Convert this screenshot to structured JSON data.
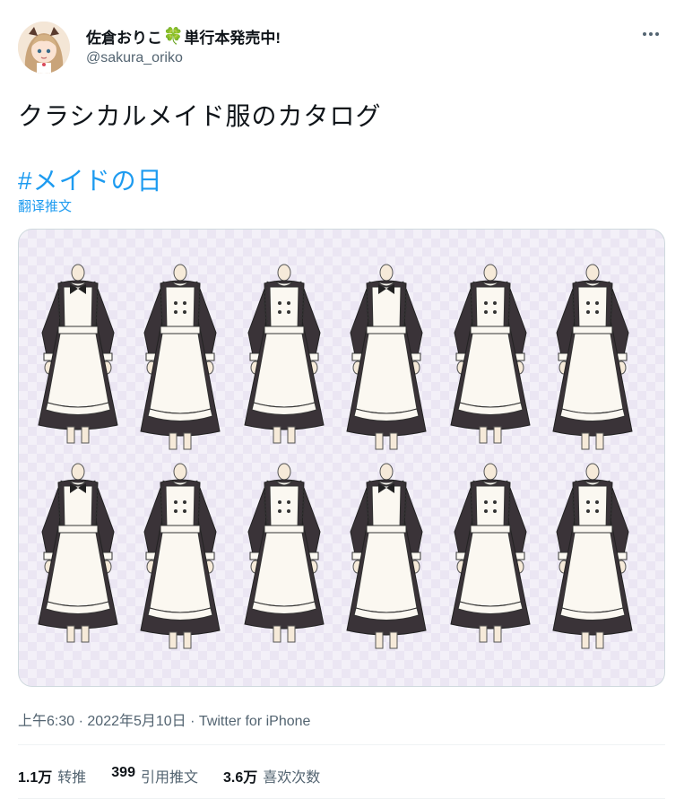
{
  "user": {
    "display_name_prefix": "佐倉おりこ",
    "clover": "🍀",
    "display_name_suffix": "単行本発売中!",
    "handle": "@sakura_oriko"
  },
  "tweet": {
    "text": "クラシカルメイド服のカタログ",
    "hashtag": "#メイドの日",
    "translate_label": "翻译推文"
  },
  "meta": {
    "time": "上午6:30",
    "date": "2022年5月10日",
    "separator": "·",
    "source": "Twitter for iPhone"
  },
  "stats": {
    "retweets": {
      "count": "1.1万",
      "label": "转推"
    },
    "quotes": {
      "count": "399",
      "label": "引用推文"
    },
    "likes": {
      "count": "3.6万",
      "label": "喜欢次数"
    }
  },
  "icons": {
    "more": "more-options-icon"
  },
  "colors": {
    "accent": "#1d9bf0",
    "secondary_text": "#536471",
    "dress_dark": "#3a3338",
    "apron": "#fbf8f1"
  }
}
